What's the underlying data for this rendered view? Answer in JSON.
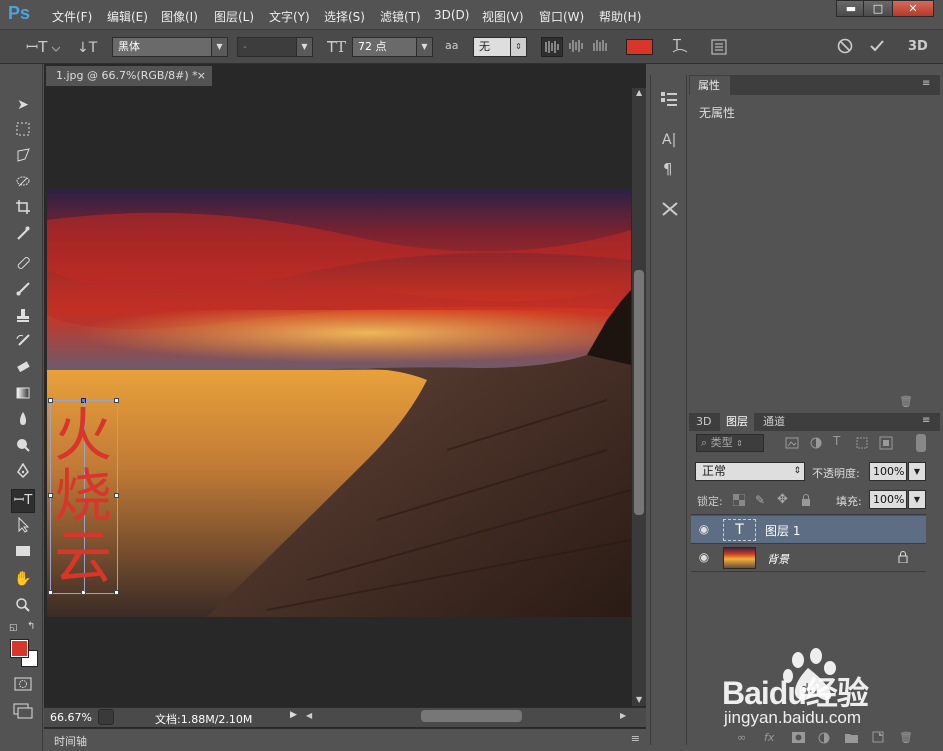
{
  "app": {
    "logo": "Ps"
  },
  "menu": [
    "文件(F)",
    "编辑(E)",
    "图像(I)",
    "图层(L)",
    "文字(Y)",
    "选择(S)",
    "滤镜(T)",
    "3D(D)",
    "视图(V)",
    "窗口(W)",
    "帮助(H)"
  ],
  "window_controls": {
    "minimize": "▬",
    "maximize": "□",
    "close": "✕"
  },
  "options": {
    "font_family": "黑体",
    "font_style": "-",
    "font_size": "72 点",
    "antialias_icon": "aa",
    "antialias": "无",
    "text_color": "#d8352b",
    "threed_label": "3D"
  },
  "document": {
    "tab_title": "1.jpg @ 66.7%(RGB/8#) *",
    "tab_close": "×"
  },
  "canvas_text": {
    "chars": [
      "火",
      "烧",
      "云"
    ],
    "color": "#d8352b"
  },
  "status": {
    "zoom": "66.67%",
    "doc_info": "文档:1.88M/2.10M",
    "timeline": "时间轴"
  },
  "properties": {
    "tab": "属性",
    "content": "无属性"
  },
  "layers_panel": {
    "tabs": [
      "3D",
      "图层",
      "通道"
    ],
    "filter_kind": "类型",
    "blend_mode": "正常",
    "opacity_label": "不透明度:",
    "opacity": "100%",
    "lock_label": "锁定:",
    "fill_label": "填充:",
    "fill": "100%",
    "layers": [
      {
        "name": "图层 1",
        "type_icon": "T",
        "selected": true
      },
      {
        "name": "背景",
        "locked": true
      }
    ]
  },
  "watermark": {
    "brand": "Baidu经验",
    "url": "jingyan.baidu.com"
  }
}
